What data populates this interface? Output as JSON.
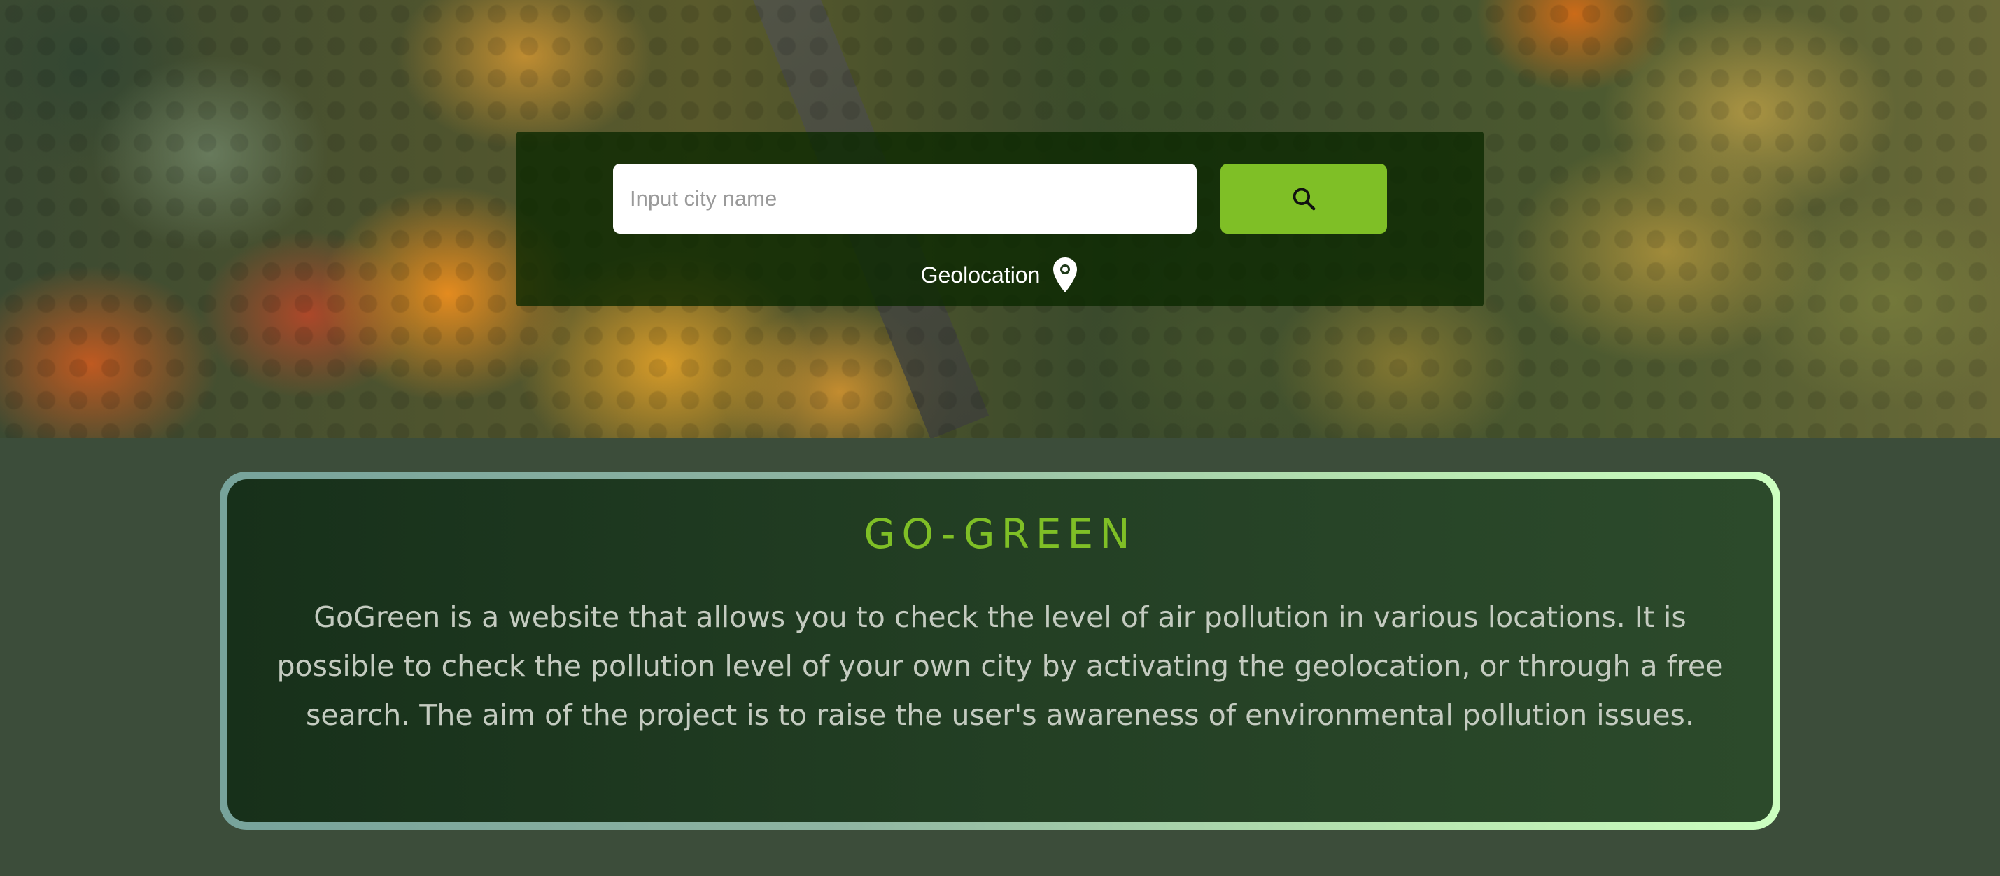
{
  "search": {
    "placeholder": "Input city name",
    "value": "",
    "button_icon": "search-icon"
  },
  "geolocation": {
    "label": "Geolocation",
    "icon": "map-pin-icon"
  },
  "info": {
    "title": "GO-GREEN",
    "description": "GoGreen is a website that allows you to check the level of air pollution in various locations. It is possible to check the pollution level of your own city by activating the geolocation, or through a free search. The aim of the project is to raise the user's awareness of environmental pollution issues."
  },
  "colors": {
    "accent": "#7fbf26",
    "page_background": "#3c4d3a",
    "panel_background": "#0a2800",
    "card_border_start": "#77a39b",
    "card_border_end": "#ccffc0",
    "text_muted": "#c4cbc0"
  }
}
